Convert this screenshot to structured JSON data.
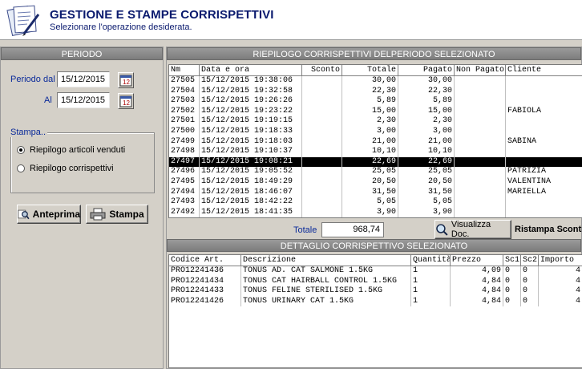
{
  "header": {
    "title": "GESTIONE E STAMPE CORRISPETTIVI",
    "subtitle": "Selezionare l'operazione desiderata."
  },
  "left": {
    "heading": "PERIODO",
    "periodo_dal_label": "Periodo dal",
    "periodo_dal_value": "15/12/2015",
    "al_label": "Al",
    "al_value": "15/12/2015",
    "stampa_label": "Stampa..",
    "radios": [
      {
        "label": "Riepilogo articoli venduti",
        "checked": true
      },
      {
        "label": "Riepilogo corrispettivi",
        "checked": false
      }
    ],
    "anteprima_label": "Anteprima",
    "stampa_button_label": "Stampa"
  },
  "riepilogo": {
    "heading": "RIEPILOGO CORRISPETTIVI DELPERIODO SELEZIONATO",
    "columns": [
      "Nm",
      "Data e ora",
      "Sconto",
      "Totale",
      "Pagato",
      "Non Pagato",
      "Cliente"
    ],
    "rows": [
      {
        "nm": "27505",
        "data": "15/12/2015 19:38:06",
        "sconto": "",
        "totale": "30,00",
        "pagato": "30,00",
        "non_pagato": "",
        "cliente": ""
      },
      {
        "nm": "27504",
        "data": "15/12/2015 19:32:58",
        "sconto": "",
        "totale": "22,30",
        "pagato": "22,30",
        "non_pagato": "",
        "cliente": ""
      },
      {
        "nm": "27503",
        "data": "15/12/2015 19:26:26",
        "sconto": "",
        "totale": "5,89",
        "pagato": "5,89",
        "non_pagato": "",
        "cliente": ""
      },
      {
        "nm": "27502",
        "data": "15/12/2015 19:23:22",
        "sconto": "",
        "totale": "15,00",
        "pagato": "15,00",
        "non_pagato": "",
        "cliente": "FABIOLA"
      },
      {
        "nm": "27501",
        "data": "15/12/2015 19:19:15",
        "sconto": "",
        "totale": "2,30",
        "pagato": "2,30",
        "non_pagato": "",
        "cliente": ""
      },
      {
        "nm": "27500",
        "data": "15/12/2015 19:18:33",
        "sconto": "",
        "totale": "3,00",
        "pagato": "3,00",
        "non_pagato": "",
        "cliente": ""
      },
      {
        "nm": "27499",
        "data": "15/12/2015 19:18:03",
        "sconto": "",
        "totale": "21,00",
        "pagato": "21,00",
        "non_pagato": "",
        "cliente": "SABINA"
      },
      {
        "nm": "27498",
        "data": "15/12/2015 19:10:37",
        "sconto": "",
        "totale": "10,10",
        "pagato": "10,10",
        "non_pagato": "",
        "cliente": ""
      },
      {
        "nm": "27497",
        "data": "15/12/2015 19:08:21",
        "sconto": "",
        "totale": "22,69",
        "pagato": "22,69",
        "non_pagato": "",
        "cliente": "",
        "selected": true
      },
      {
        "nm": "27496",
        "data": "15/12/2015 19:05:52",
        "sconto": "",
        "totale": "25,05",
        "pagato": "25,05",
        "non_pagato": "",
        "cliente": "PATRIZIA"
      },
      {
        "nm": "27495",
        "data": "15/12/2015 18:49:29",
        "sconto": "",
        "totale": "20,50",
        "pagato": "20,50",
        "non_pagato": "",
        "cliente": "VALENTINA"
      },
      {
        "nm": "27494",
        "data": "15/12/2015 18:46:07",
        "sconto": "",
        "totale": "31,50",
        "pagato": "31,50",
        "non_pagato": "",
        "cliente": "MARIELLA"
      },
      {
        "nm": "27493",
        "data": "15/12/2015 18:42:22",
        "sconto": "",
        "totale": "5,05",
        "pagato": "5,05",
        "non_pagato": "",
        "cliente": ""
      },
      {
        "nm": "27492",
        "data": "15/12/2015 18:41:35",
        "sconto": "",
        "totale": "3,90",
        "pagato": "3,90",
        "non_pagato": "",
        "cliente": ""
      }
    ],
    "totale_label": "Totale",
    "totale_value": "968,74",
    "visualizza_label": "Visualizza Doc.",
    "ristampa_label": "Ristampa Scontrino"
  },
  "dettaglio": {
    "heading": "DETTAGLIO CORRISPETTIVO SELEZIONATO",
    "columns": [
      "Codice Art.",
      "Descrizione",
      "Quantità",
      "Prezzo",
      "Sc1",
      "Sc2",
      "Importo"
    ],
    "rows": [
      {
        "codice": "PRO12241436",
        "descrizione": "TONUS AD. CAT SALMONE 1.5KG",
        "quantita": "1",
        "prezzo": "4,09",
        "sc1": "0",
        "sc2": "0",
        "importo": "4"
      },
      {
        "codice": "PRO12241434",
        "descrizione": "TONUS CAT HAIRBALL CONTROL 1.5KG",
        "quantita": "1",
        "prezzo": "4,84",
        "sc1": "0",
        "sc2": "0",
        "importo": "4"
      },
      {
        "codice": "PRO12241433",
        "descrizione": "TONUS FELINE STERILISED 1.5KG",
        "quantita": "1",
        "prezzo": "4,84",
        "sc1": "0",
        "sc2": "0",
        "importo": "4"
      },
      {
        "codice": "PRO12241426",
        "descrizione": "TONUS URINARY CAT 1.5KG",
        "quantita": "1",
        "prezzo": "4,84",
        "sc1": "0",
        "sc2": "0",
        "importo": "4"
      }
    ]
  }
}
